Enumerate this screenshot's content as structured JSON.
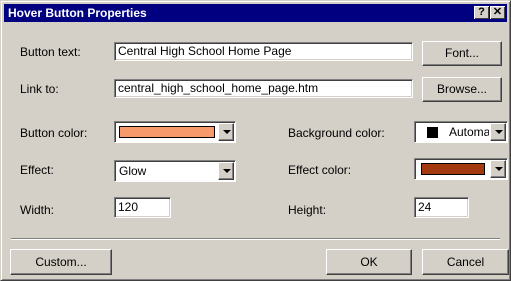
{
  "window": {
    "title": "Hover Button Properties",
    "help_label": "?",
    "close_label": "✕"
  },
  "form": {
    "button_text": {
      "label": "Button text:",
      "value": "Central High School Home Page"
    },
    "link_to": {
      "label": "Link to:",
      "value": "central_high_school_home_page.htm"
    },
    "button_color": {
      "label": "Button color:",
      "value": "#f79a6b"
    },
    "background_color": {
      "label": "Background color:",
      "value": "Automa",
      "swatch": "#000000"
    },
    "effect": {
      "label": "Effect:",
      "value": "Glow"
    },
    "effect_color": {
      "label": "Effect color:",
      "value": "#a33a0f"
    },
    "width": {
      "label": "Width:",
      "value": "120"
    },
    "height": {
      "label": "Height:",
      "value": "24"
    }
  },
  "buttons": {
    "font": "Font...",
    "browse": "Browse...",
    "custom": "Custom...",
    "ok": "OK",
    "cancel": "Cancel"
  }
}
